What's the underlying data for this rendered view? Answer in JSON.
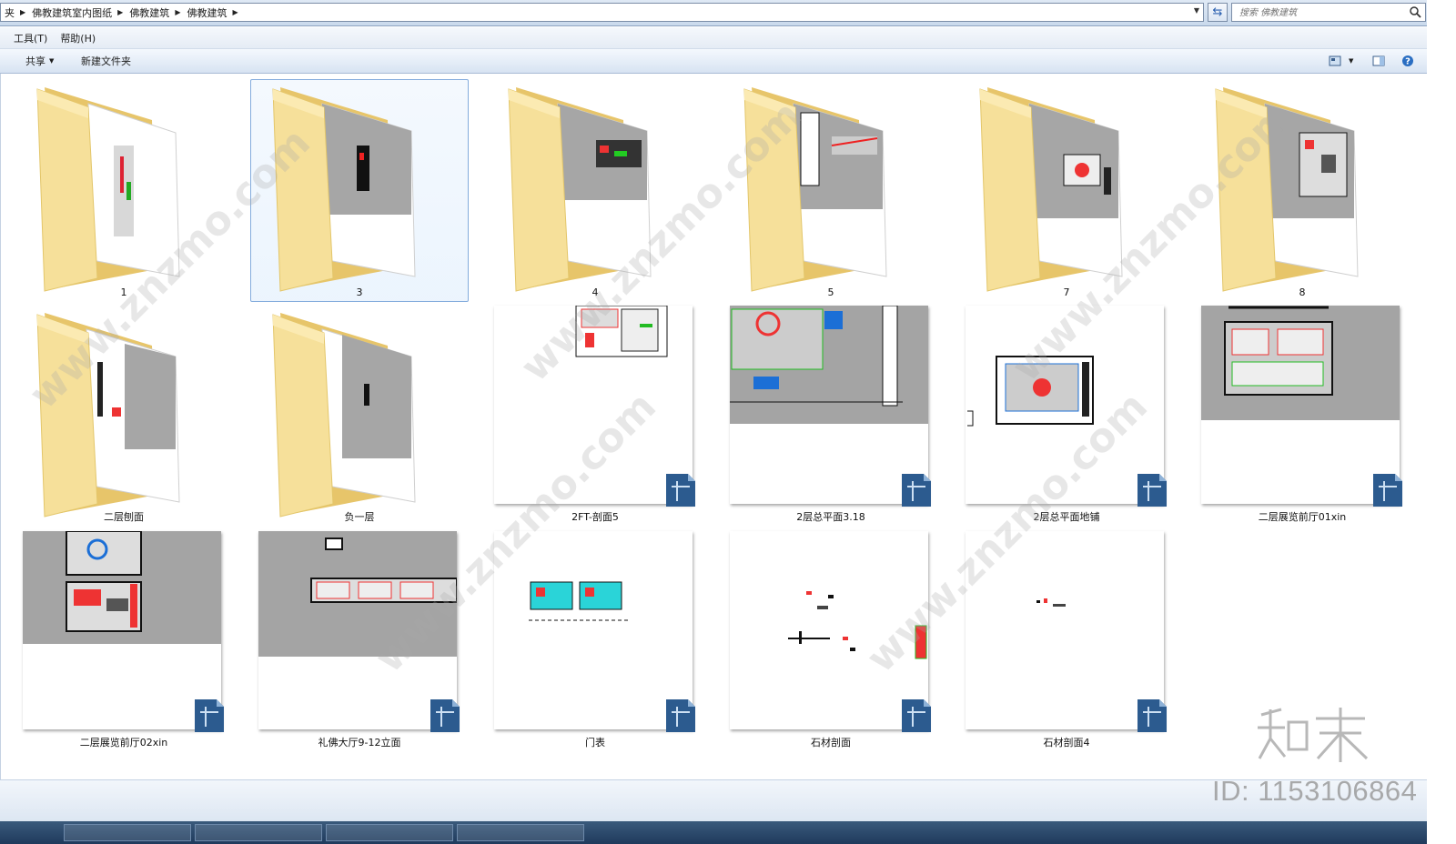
{
  "address_bar": {
    "crumbs": [
      "夹",
      "佛教建筑室内图纸",
      "佛教建筑",
      "佛教建筑"
    ],
    "search_placeholder": "搜索 佛教建筑"
  },
  "menu": {
    "items": [
      "工具(T)",
      "帮助(H)"
    ]
  },
  "commandbar": {
    "share_label": "共享",
    "new_folder_label": "新建文件夹",
    "icons": [
      "view-options-icon",
      "preview-pane-icon",
      "help-icon"
    ]
  },
  "items": [
    {
      "name": "1",
      "kind": "folder"
    },
    {
      "name": "3",
      "kind": "folder",
      "selected": true
    },
    {
      "name": "4",
      "kind": "folder"
    },
    {
      "name": "5",
      "kind": "folder"
    },
    {
      "name": "7",
      "kind": "folder"
    },
    {
      "name": "8",
      "kind": "folder"
    },
    {
      "name": "二层刨面",
      "kind": "folder"
    },
    {
      "name": "负一层",
      "kind": "folder"
    },
    {
      "name": "2FT-剖面5",
      "kind": "dwg"
    },
    {
      "name": "2层总平面3.18",
      "kind": "dwg"
    },
    {
      "name": "2层总平面地铺",
      "kind": "dwg"
    },
    {
      "name": "二层展览前厅01xin",
      "kind": "dwg"
    },
    {
      "name": "二层展览前厅02xin",
      "kind": "dwg"
    },
    {
      "name": "礼佛大厅9-12立面",
      "kind": "dwg"
    },
    {
      "name": "门表",
      "kind": "dwg"
    },
    {
      "name": "石材剖面",
      "kind": "dwg"
    },
    {
      "name": "石材剖面4",
      "kind": "dwg"
    }
  ],
  "watermark": {
    "site_text": "www.znzmo.com",
    "logo_text": "知末",
    "id_text": "ID: 1153106864"
  },
  "colors": {
    "folder_front": "#f4dc8e",
    "folder_back": "#e8c86a",
    "selection_border": "#84acdd",
    "dwg_badge": "#2c5b8f"
  }
}
